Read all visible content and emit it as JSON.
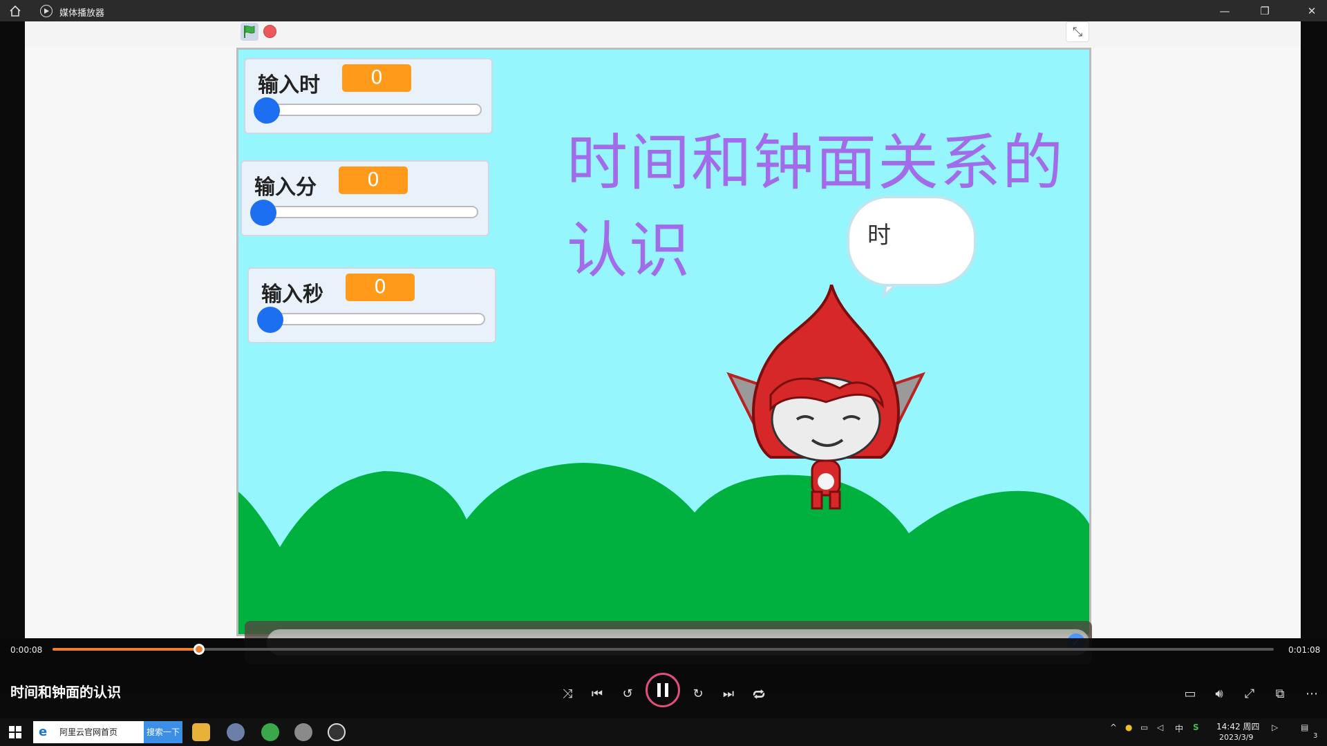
{
  "window": {
    "title": "媒体播放器"
  },
  "stage": {
    "title": "时间和钟面关系的认识",
    "bubble_text": "时",
    "variables": [
      {
        "label": "输入时",
        "value": "0"
      },
      {
        "label": "输入分",
        "value": "0"
      },
      {
        "label": "输入秒",
        "value": "0"
      }
    ]
  },
  "player": {
    "current_time": "0:00:08",
    "total_time": "0:01:08",
    "progress": 0.12,
    "video_name": "时间和钟面的认识"
  },
  "taskbar": {
    "search_text": "阿里云官网首页",
    "search_button": "搜索一下",
    "time": "14:42 周四",
    "date": "2023/3/9",
    "notification_count": "3",
    "ime": "中"
  },
  "colors": {
    "accent": "#f07e2e",
    "title": "#a16be9",
    "stage_bg": "#95f7fd",
    "hill": "#00b140",
    "monitor": "#ff9a1a",
    "slider": "#1d6ff2"
  }
}
